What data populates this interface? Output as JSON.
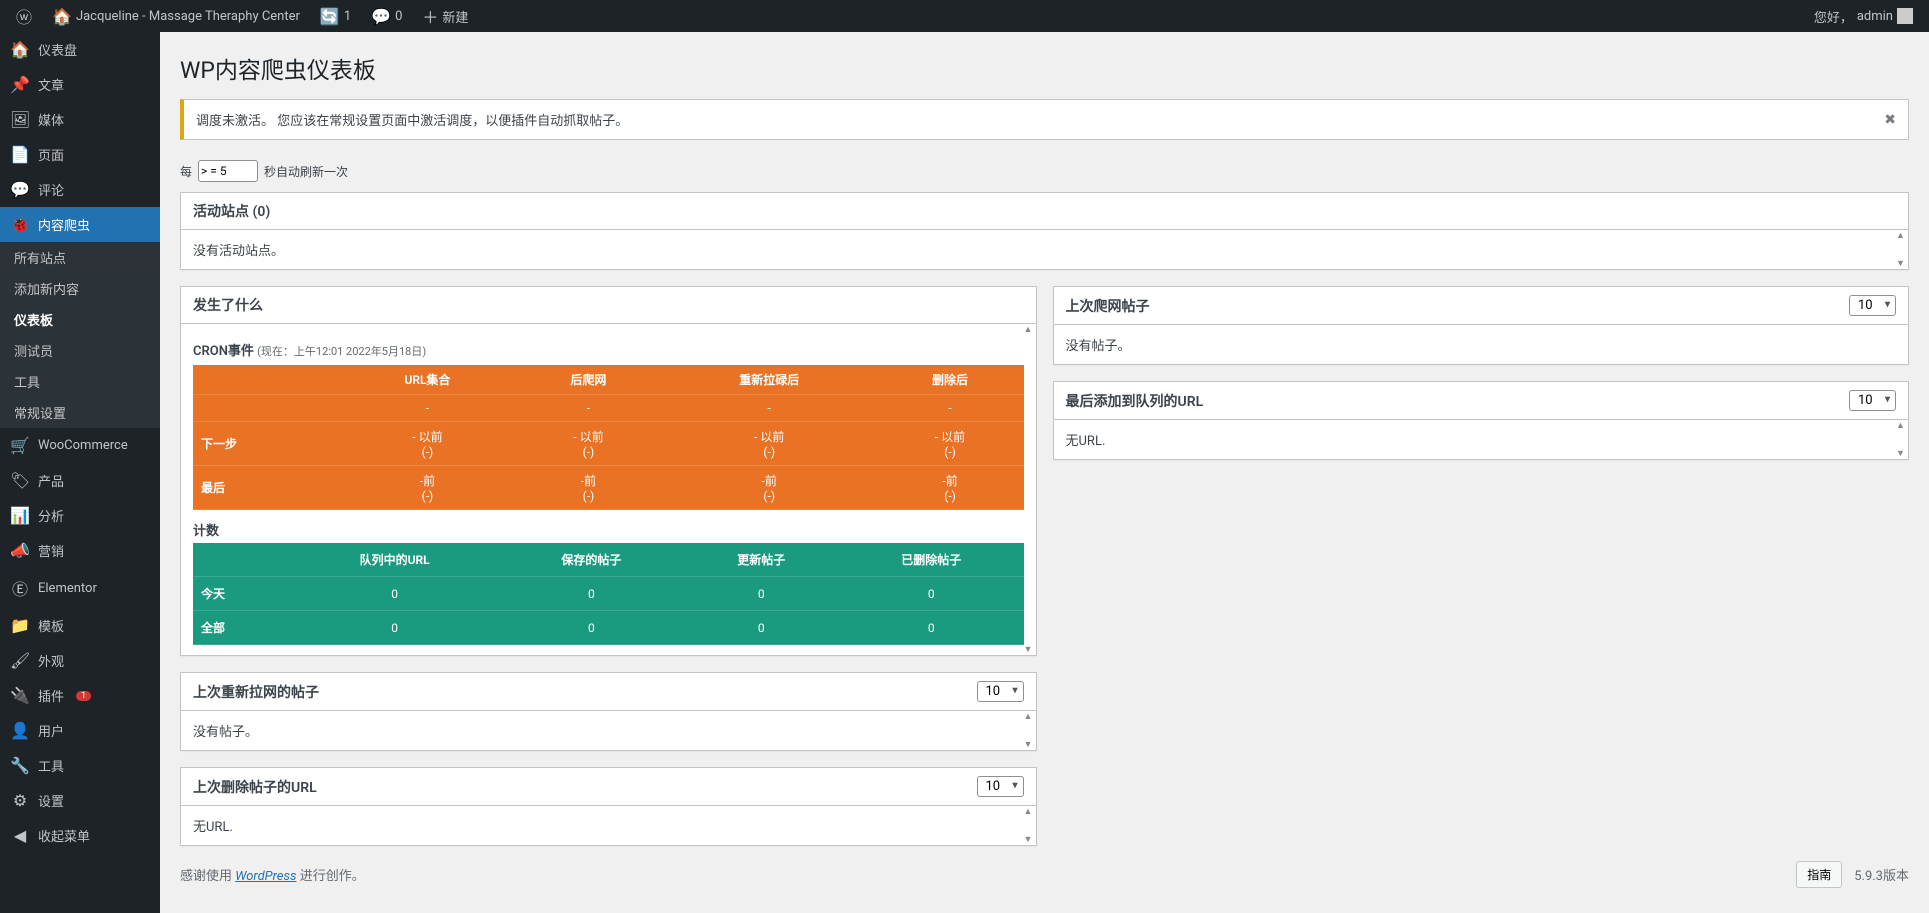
{
  "adminBar": {
    "siteTitle": "Jacqueline - Massage Theraphy Center",
    "updates": "1",
    "comments": "0",
    "new": "新建",
    "greeting": "您好，",
    "user": "admin"
  },
  "sidebar": {
    "items": [
      {
        "icon": "🏠",
        "label": "仪表盘"
      },
      {
        "icon": "📌",
        "label": "文章"
      },
      {
        "icon": "🖼",
        "label": "媒体"
      },
      {
        "icon": "📄",
        "label": "页面"
      },
      {
        "icon": "💬",
        "label": "评论"
      },
      {
        "icon": "🐞",
        "label": "内容爬虫",
        "current": true
      },
      {
        "icon": "🛒",
        "label": "WooCommerce"
      },
      {
        "icon": "🏷",
        "label": "产品"
      },
      {
        "icon": "📊",
        "label": "分析"
      },
      {
        "icon": "📣",
        "label": "营销"
      },
      {
        "icon": "Ⓔ",
        "label": "Elementor"
      },
      {
        "icon": "📁",
        "label": "模板"
      },
      {
        "icon": "🖌",
        "label": "外观"
      },
      {
        "icon": "🔌",
        "label": "插件",
        "badge": "1"
      },
      {
        "icon": "👤",
        "label": "用户"
      },
      {
        "icon": "🔧",
        "label": "工具"
      },
      {
        "icon": "⚙",
        "label": "设置"
      },
      {
        "icon": "◀",
        "label": "收起菜单"
      }
    ],
    "submenu": [
      {
        "label": "所有站点"
      },
      {
        "label": "添加新内容"
      },
      {
        "label": "仪表板",
        "current": true
      },
      {
        "label": "测试员"
      },
      {
        "label": "工具"
      },
      {
        "label": "常规设置"
      }
    ]
  },
  "page": {
    "title": "WP内容爬虫仪表板",
    "notice": "调度未激活。 您应该在常规设置页面中激活调度，以便插件自动抓取帖子。",
    "refresh_prefix": "每",
    "refresh_value": "> = 5",
    "refresh_suffix": "秒自动刷新一次"
  },
  "panels": {
    "activeSites": {
      "title": "活动站点 (0)",
      "body": "没有活动站点。"
    },
    "whatHappened": {
      "title": "发生了什么",
      "cron": "CRON事件",
      "now": "(现在：上午12:01 2022年5月18日)",
      "table1": {
        "headers": [
          "",
          "URL集合",
          "后爬网",
          "重新拉碌后",
          "删除后"
        ],
        "rows": [
          {
            "label": "",
            "cells": [
              "-",
              "-",
              "-",
              "-"
            ]
          },
          {
            "label": "下一步",
            "cells": [
              "- 以前\n(-)",
              "- 以前\n(-)",
              "- 以前\n(-)",
              "- 以前\n(-)"
            ]
          },
          {
            "label": "最后",
            "cells": [
              "-前\n(-)",
              "-前\n(-)",
              "-前\n(-)",
              "-前\n(-)"
            ]
          }
        ]
      },
      "countsTitle": "计数",
      "table2": {
        "headers": [
          "",
          "队列中的URL",
          "保存的帖子",
          "更新帖子",
          "已删除帖子"
        ],
        "rows": [
          {
            "label": "今天",
            "cells": [
              "0",
              "0",
              "0",
              "0"
            ]
          },
          {
            "label": "全部",
            "cells": [
              "0",
              "0",
              "0",
              "0"
            ]
          }
        ]
      }
    },
    "lastCrawled": {
      "title": "上次爬网帖子",
      "count": "10",
      "body": "没有帖子。"
    },
    "lastQueued": {
      "title": "最后添加到队列的URL",
      "count": "10",
      "body": "无URL."
    },
    "lastRecrawled": {
      "title": "上次重新拉网的帖子",
      "count": "10",
      "body": "没有帖子。"
    },
    "lastDeleted": {
      "title": "上次删除帖子的URL",
      "count": "10",
      "body": "无URL."
    }
  },
  "footer": {
    "thanks_prefix": "感谢使用 ",
    "wordpress": "WordPress",
    "thanks_suffix": " 进行创作。",
    "version": "5.9.3版本",
    "help": "指南"
  }
}
